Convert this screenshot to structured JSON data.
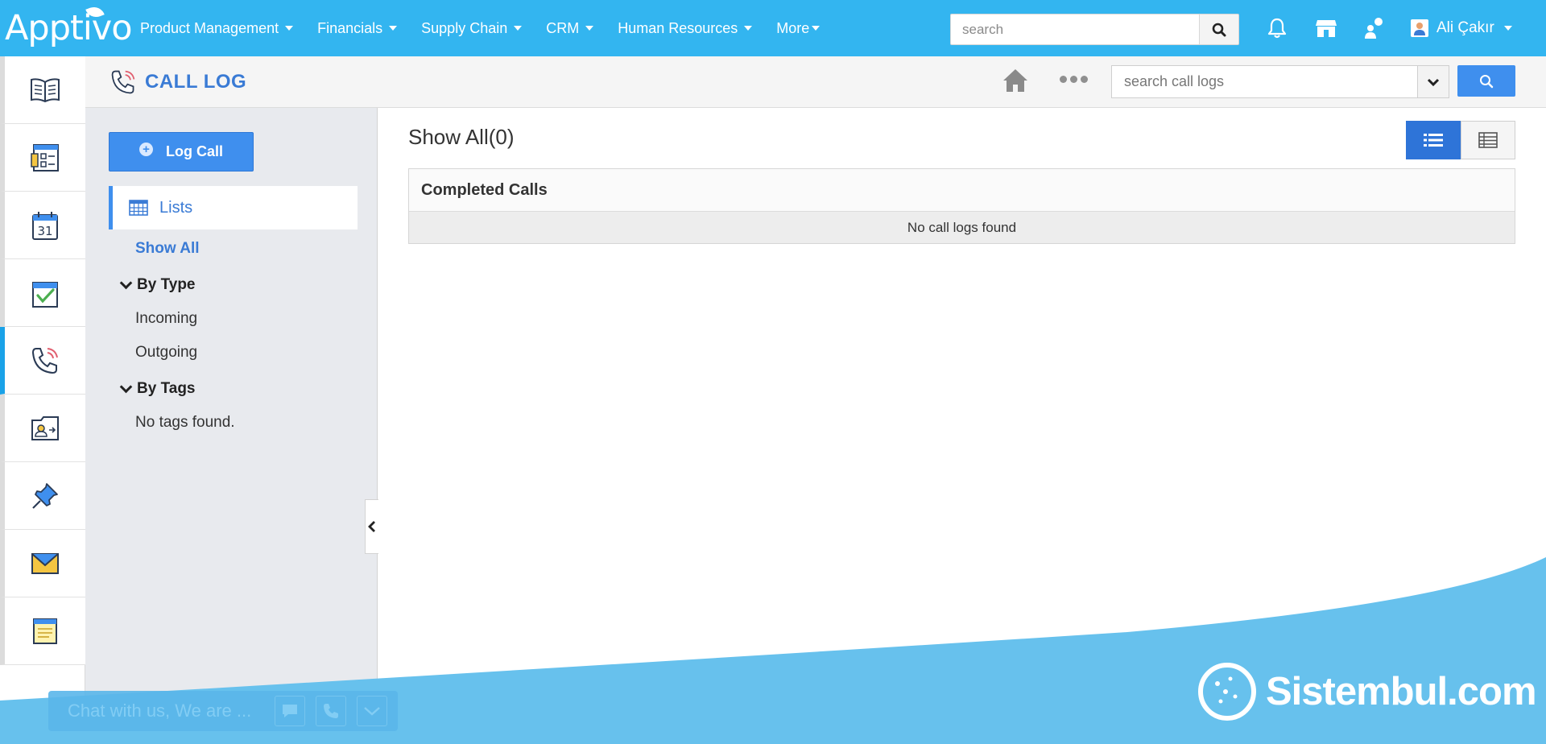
{
  "topbar": {
    "logo": "Apptivo",
    "nav": [
      {
        "label": "Product Management"
      },
      {
        "label": "Financials"
      },
      {
        "label": "Supply Chain"
      },
      {
        "label": "CRM"
      },
      {
        "label": "Human Resources"
      },
      {
        "label": "More"
      }
    ],
    "search_placeholder": "search",
    "user_name": "Ali Çakır"
  },
  "rail": {
    "items": [
      {
        "icon": "book-icon"
      },
      {
        "icon": "form-icon"
      },
      {
        "icon": "calendar-icon",
        "text": "31"
      },
      {
        "icon": "task-check-icon"
      },
      {
        "icon": "phone-icon",
        "active": true
      },
      {
        "icon": "contact-card-icon"
      },
      {
        "icon": "pushpin-icon"
      },
      {
        "icon": "envelope-icon"
      },
      {
        "icon": "notepad-icon"
      }
    ]
  },
  "subheader": {
    "title": "CALL LOG",
    "search_placeholder": "search call logs"
  },
  "leftpanel": {
    "log_call_label": "Log Call",
    "lists_label": "Lists",
    "show_all_label": "Show All",
    "by_type_label": "By Type",
    "incoming_label": "Incoming",
    "outgoing_label": "Outgoing",
    "by_tags_label": "By Tags",
    "no_tags_label": "No tags found."
  },
  "main": {
    "title": "Show All(0)",
    "table_header": "Completed Calls",
    "empty_message": "No call logs found"
  },
  "footer": {
    "chat_text": "Chat with us, We are ...",
    "brand": "Sistembul.com"
  },
  "colors": {
    "topbar": "#33b5f0",
    "accent": "#3f8fee",
    "title_blue": "#3a7bd5",
    "wave": "#67c1ed"
  }
}
